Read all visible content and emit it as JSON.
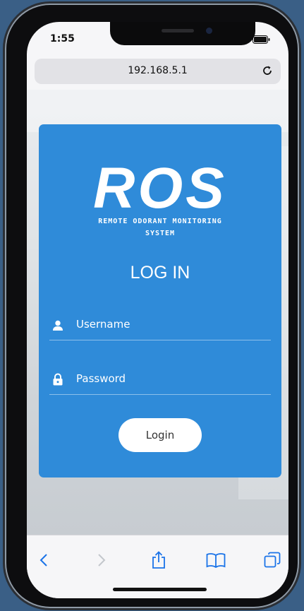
{
  "status_bar": {
    "time": "1:55"
  },
  "browser": {
    "address": "192.168.5.1"
  },
  "login": {
    "logo_text": "ROS",
    "logo_subtitle_line1": "REMOTE ODORANT MONITORING",
    "logo_subtitle_line2": "SYSTEM",
    "title": "LOG IN",
    "username_placeholder": "Username",
    "password_placeholder": "Password",
    "login_button": "Login"
  },
  "colors": {
    "card_blue": "#2f8bd9",
    "ios_blue": "#1a73e8",
    "bezel": "#0d0d0f"
  },
  "icons": [
    "signal-icon",
    "wifi-icon",
    "battery-icon",
    "reload-icon",
    "user-icon",
    "lock-icon",
    "back-icon",
    "forward-icon",
    "share-icon",
    "bookmarks-icon",
    "tabs-icon"
  ]
}
